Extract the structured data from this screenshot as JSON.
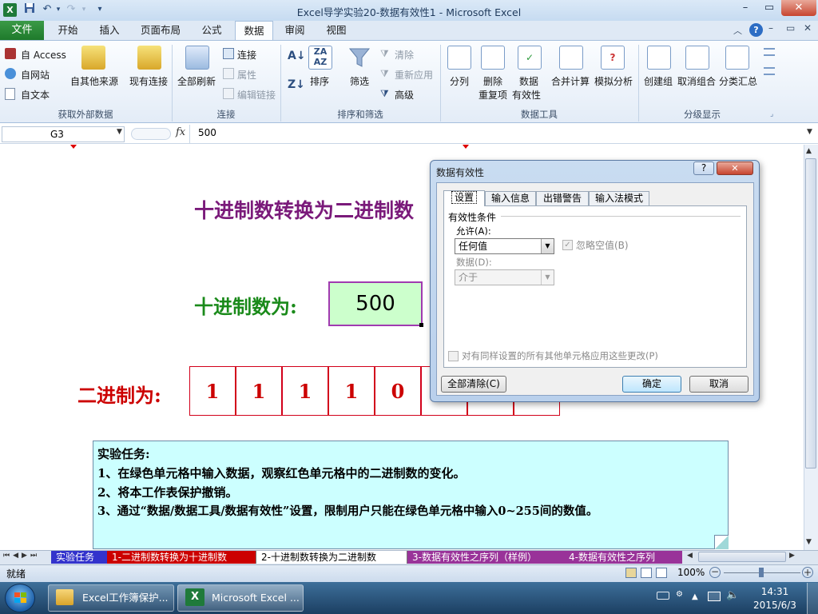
{
  "window": {
    "title": "Excel导学实验20-数据有效性1 - Microsoft Excel",
    "min": "–",
    "max": "▭",
    "close": "✕"
  },
  "quick_access": {
    "undo": "↶",
    "redo": "↷",
    "dropdown": "▾"
  },
  "ribbon_tabs": [
    "文件",
    "开始",
    "插入",
    "页面布局",
    "公式",
    "数据",
    "审阅",
    "视图"
  ],
  "ribbon": {
    "get_external": {
      "access": "自 Access",
      "web": "自网站",
      "text": "自文本",
      "other": "自其他来源",
      "existing": "现有连接",
      "group": "获取外部数据"
    },
    "connections": {
      "refresh_all": "全部刷新",
      "connections": "连接",
      "properties": "属性",
      "edit_links": "编辑链接",
      "group": "连接"
    },
    "sort_filter": {
      "sort": "排序",
      "filter": "筛选",
      "clear": "清除",
      "reapply": "重新应用",
      "advanced": "高级",
      "group": "排序和筛选"
    },
    "data_tools": {
      "text_to_columns": "分列",
      "remove_dup_1": "删除",
      "remove_dup_2": "重复项",
      "validation_1": "数据",
      "validation_2": "有效性",
      "consolidate": "合并计算",
      "what_if": "模拟分析",
      "group": "数据工具"
    },
    "outline": {
      "group_btn": "创建组",
      "ungroup": "取消组合",
      "subtotal": "分类汇总",
      "group": "分级显示"
    }
  },
  "formula_bar": {
    "name_box": "G3",
    "fx": "fx",
    "value": "500"
  },
  "sheet": {
    "title": "十进制数转换为二进制数",
    "decimal_label": "十进制数为:",
    "decimal_value": "500",
    "binary_label": "二进制为:",
    "binary_digits": [
      "1",
      "1",
      "1",
      "1",
      "0",
      "",
      "",
      ""
    ],
    "task_title": "实验任务:",
    "task_1": "1、在绿色单元格中输入数据，观察红色单元格中的二进制数的变化。",
    "task_2": "2、将本工作表保护撤销。",
    "task_3": "3、通过“数据/数据工具/数据有效性”设置，限制用户只能在绿色单元格中输入0~255间的数值。"
  },
  "dialog": {
    "title": "数据有效性",
    "help": "?",
    "close": "✕",
    "tabs": [
      "设置",
      "输入信息",
      "出错警告",
      "输入法模式"
    ],
    "criteria_heading": "有效性条件",
    "allow_label": "允许(A):",
    "allow_value": "任何值",
    "ignore_blank": "忽略空值(B)",
    "data_label": "数据(D):",
    "data_value": "介于",
    "apply_all": "对有同样设置的所有其他单元格应用这些更改(P)",
    "clear_all": "全部清除(C)",
    "ok": "确定",
    "cancel": "取消"
  },
  "sheet_tabs": {
    "tabs": [
      "实验任务",
      "1-二进制数转换为十进制数",
      "2-十进制数转换为二进制数",
      "3-数据有效性之序列（样例）",
      "4-数据有效性之序列"
    ],
    "active_index": 2,
    "colors": [
      "#3333cc",
      "#cc0000",
      "#ffffff",
      "#993399",
      "#993399"
    ]
  },
  "status_bar": {
    "ready": "就绪",
    "zoom": "100%"
  },
  "taskbar": {
    "tasks": [
      "Excel工作簿保护...",
      "Microsoft Excel ..."
    ],
    "time": "14:31",
    "date": "2015/6/3"
  }
}
